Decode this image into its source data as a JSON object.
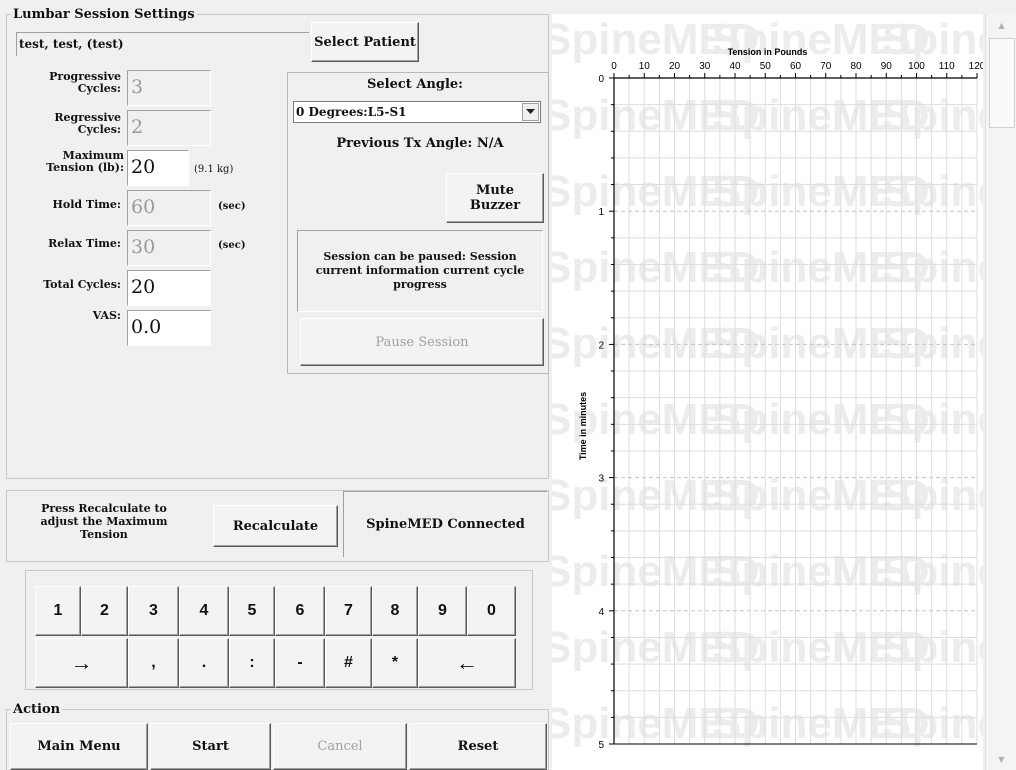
{
  "session": {
    "title": "Lumbar Session Settings",
    "patient_name": "test, test, (test)",
    "select_patient_label": "Select Patient"
  },
  "fields": {
    "progressive_cycles": {
      "label_line1": "Progressive",
      "label_line2": "Cycles:",
      "value": "3"
    },
    "regressive_cycles": {
      "label_line1": "Regressive",
      "label_line2": "Cycles:",
      "value": "2"
    },
    "maximum_tension": {
      "label_line1": "Maximum",
      "label_line2": "Tension (lb):",
      "value": "20",
      "unit": "(9.1 kg)"
    },
    "hold_time": {
      "label": "Hold Time:",
      "value": "60",
      "unit": "(sec)"
    },
    "relax_time": {
      "label": "Relax Time:",
      "value": "30",
      "unit": "(sec)"
    },
    "total_cycles": {
      "label": "Total Cycles:",
      "value": "20"
    },
    "vas": {
      "label": "VAS:",
      "value": "0.0"
    }
  },
  "angle": {
    "title": "Select Angle:",
    "selected": "0 Degrees:L5-S1",
    "previous_label": "Previous Tx Angle: N/A",
    "mute_label_line1": "Mute",
    "mute_label_line2": "Buzzer",
    "status_text": "Session can be paused: Session current information current cycle progress",
    "pause_label": "Pause Session"
  },
  "recalc": {
    "hint": "Press Recalculate to adjust the Maximum Tension",
    "button_label": "Recalculate",
    "status": "SpineMED Connected"
  },
  "keypad": {
    "row1": [
      "1",
      "2",
      "3",
      "4",
      "5",
      "6",
      "7",
      "8",
      "9",
      "0"
    ],
    "row2": [
      "→",
      ",",
      ".",
      ":",
      "-",
      "#",
      "*",
      "←"
    ]
  },
  "action": {
    "title": "Action",
    "main_menu": "Main Menu",
    "start": "Start",
    "cancel": "Cancel",
    "reset": "Reset"
  },
  "chart_data": {
    "type": "line",
    "title": "",
    "xlabel": "Tension in Pounds",
    "ylabel": "Time in minutes",
    "x_ticks": [
      0,
      10,
      20,
      30,
      40,
      50,
      60,
      70,
      80,
      90,
      100,
      110,
      120
    ],
    "y_ticks": [
      0,
      1,
      2,
      3,
      4,
      5
    ],
    "xlim": [
      0,
      120
    ],
    "ylim": [
      0,
      5
    ],
    "grid": true,
    "series": [],
    "watermark": "SpineMED"
  },
  "colors": {
    "grid_minor": "#dedede",
    "grid_major": "#c4c4c4",
    "watermark": "#ececec"
  }
}
